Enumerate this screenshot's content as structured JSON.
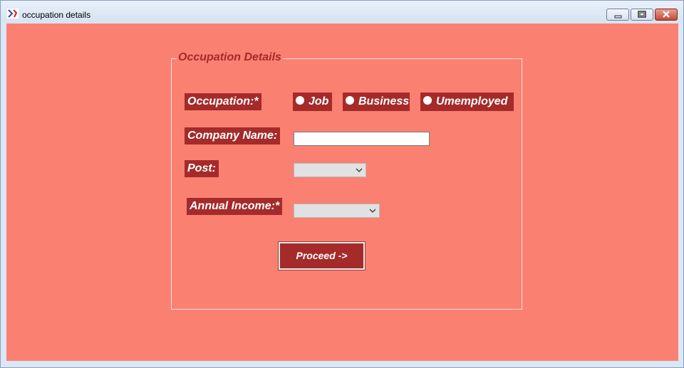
{
  "window": {
    "title": "occupation details",
    "icon": "python-feather-icon"
  },
  "form": {
    "legend": "Occupation Details",
    "occupation": {
      "label": "Occupation:*",
      "options": [
        "Job",
        "Business",
        "Umemployed"
      ]
    },
    "company": {
      "label": "Company Name:",
      "value": ""
    },
    "post": {
      "label": "Post:",
      "value": ""
    },
    "income": {
      "label": "Annual Income:*",
      "value": ""
    },
    "proceed_label": "Proceed ->"
  },
  "colors": {
    "background": "#fa8072",
    "label_bg": "#a52a2a",
    "label_text": "#ffffff"
  }
}
